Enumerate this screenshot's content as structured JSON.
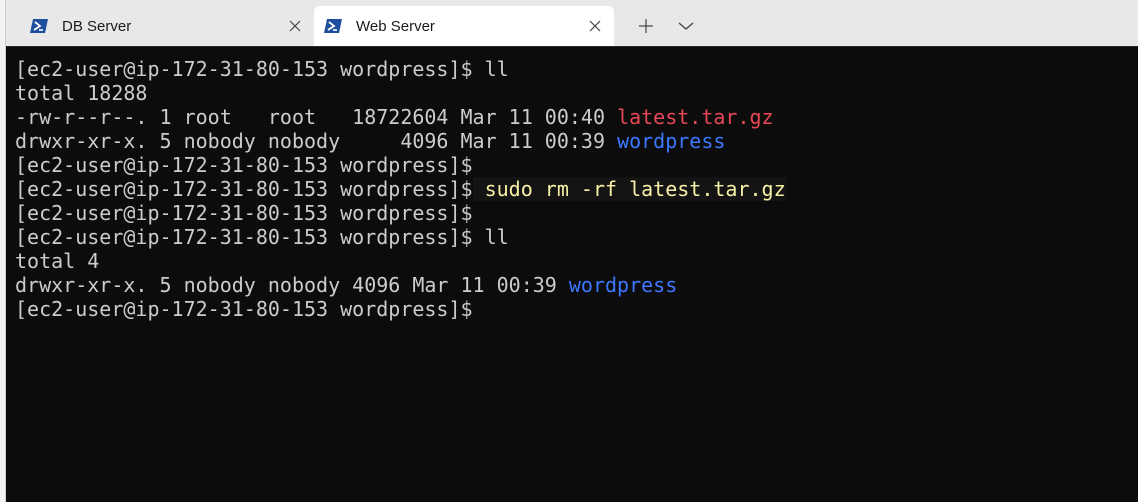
{
  "tabs": [
    {
      "label": "DB Server",
      "active": false,
      "icon": "powershell-icon"
    },
    {
      "label": "Web Server",
      "active": true,
      "icon": "powershell-icon"
    }
  ],
  "colors": {
    "tab_bar_bg": "#e8e8e8",
    "terminal_bg": "#0c0c0c",
    "terminal_fg": "#cccccc",
    "file_red": "#e74856",
    "dir_blue": "#3b78ff",
    "command_yellow": "#f9f1a5",
    "icon_blue": "#1e4e9e"
  },
  "terminal": {
    "prompt": "[ec2-user@ip-172-31-80-153 wordpress]$",
    "lines": {
      "l1_cmd": " ll",
      "l2": "total 18288",
      "l3_meta": "-rw-r--r--. 1 root   root   18722604 Mar 11 00:40 ",
      "l3_name": "latest.tar.gz",
      "l4_meta": "drwxr-xr-x. 5 nobody nobody     4096 Mar 11 00:39 ",
      "l4_name": "wordpress",
      "l6_cmd": " sudo rm -rf latest.tar.gz",
      "l8_cmd": " ll",
      "l9": "total 4",
      "l10_meta": "drwxr-xr-x. 5 nobody nobody 4096 Mar 11 00:39 ",
      "l10_name": "wordpress"
    }
  }
}
